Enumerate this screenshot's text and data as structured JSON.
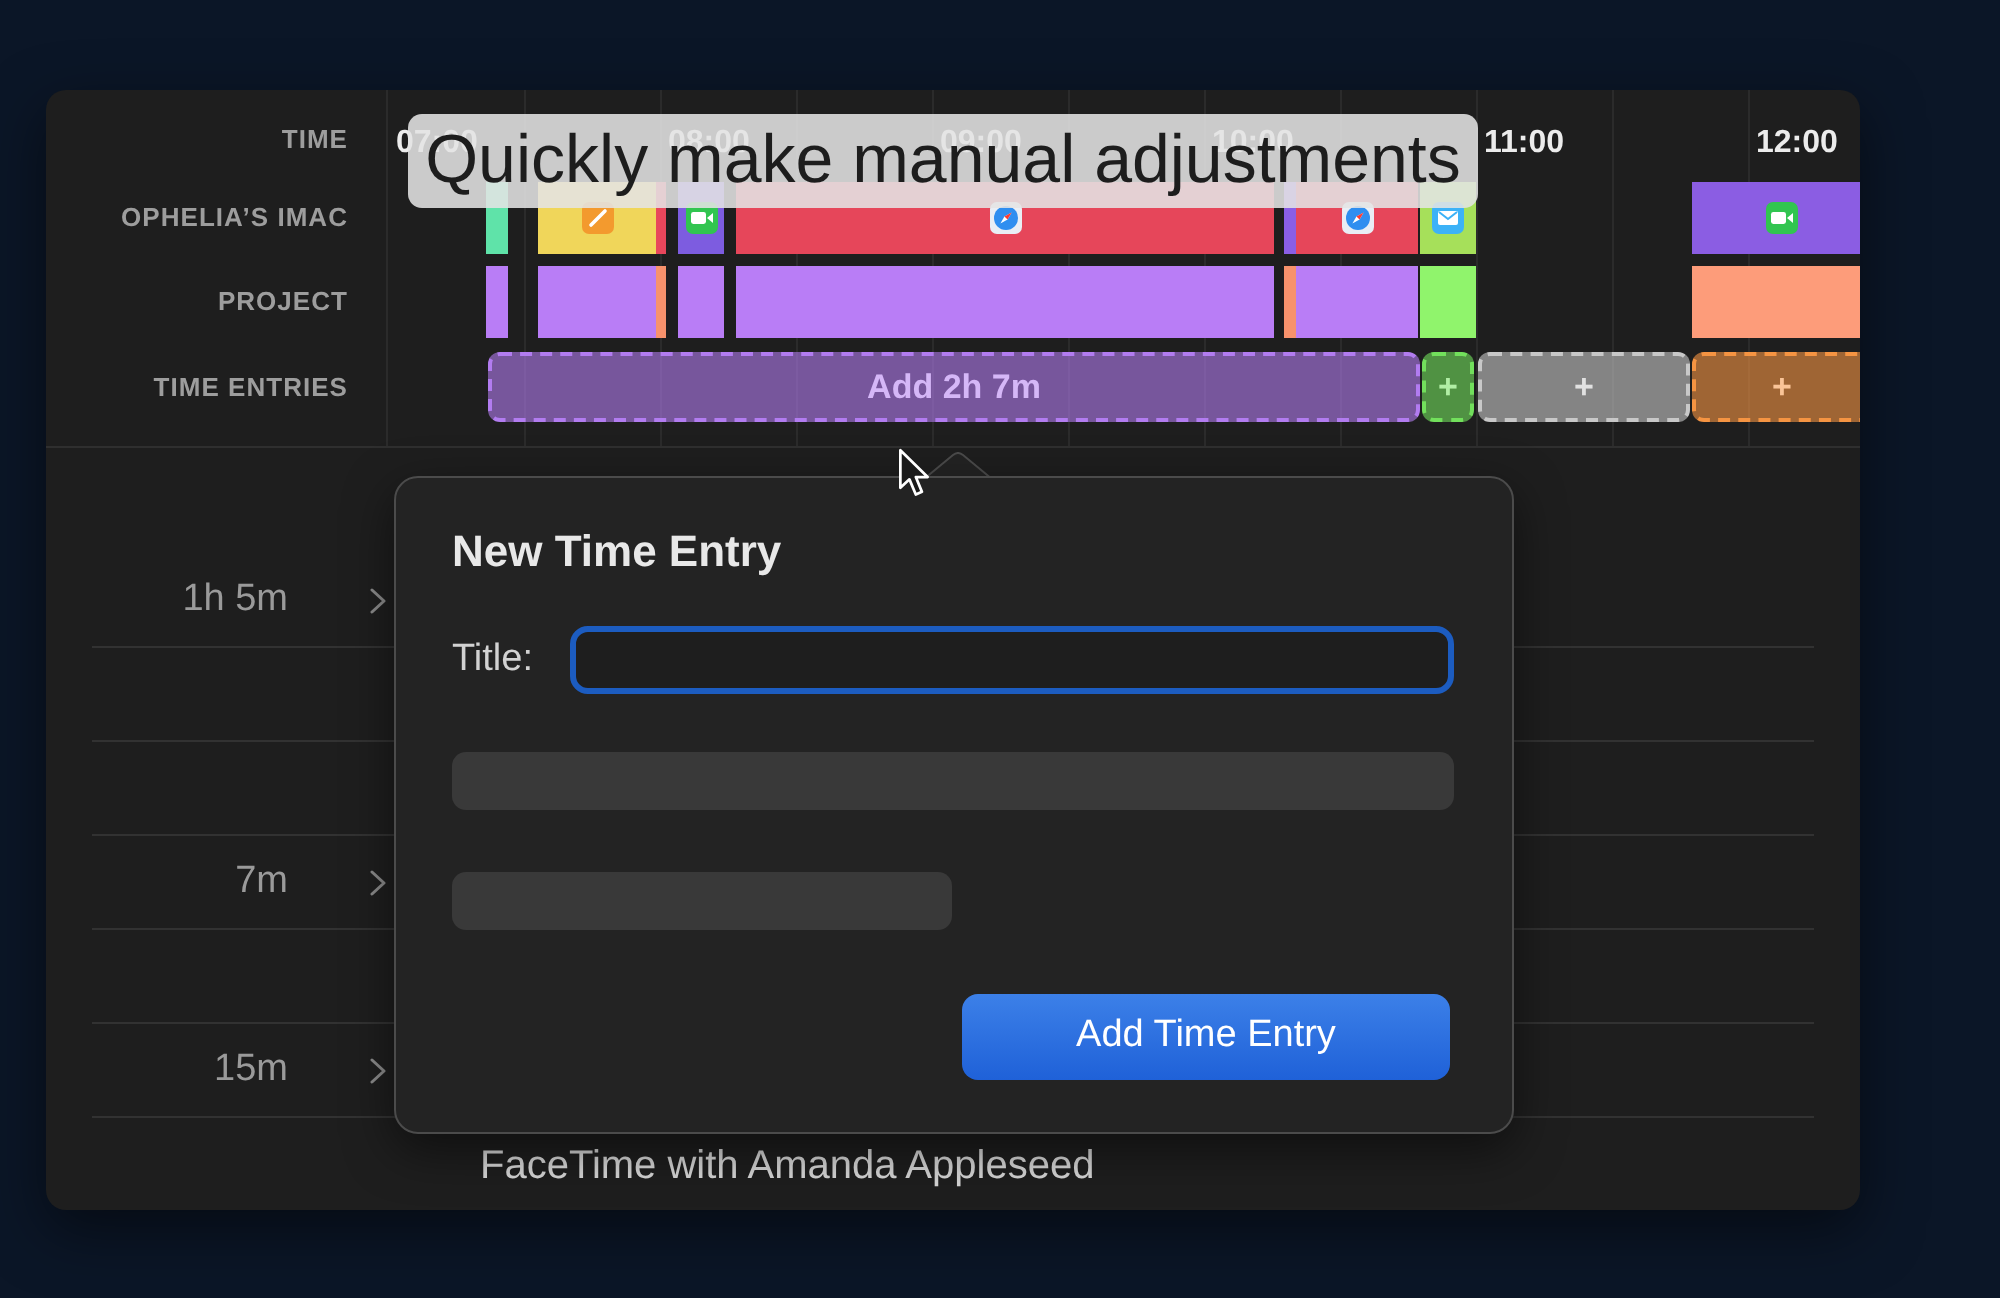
{
  "caption": "Quickly make manual adjustments",
  "timeline": {
    "row_labels": [
      "TIME",
      "OPHELIA’S IMAC",
      "PROJECT",
      "TIME ENTRIES"
    ],
    "hours": [
      "07:00",
      "08:00",
      "09:00",
      "10:00",
      "11:00",
      "12:00"
    ],
    "app_blocks": [
      {
        "color": "#5fe3a9",
        "kind": "plain"
      },
      {
        "color": "#f0d65a",
        "kind": "pencil"
      },
      {
        "color": "#e8465b",
        "kind": "plain"
      },
      {
        "color": "#7d5ce0",
        "kind": "video"
      },
      {
        "color": "#e6465a",
        "kind": "compass"
      },
      {
        "color": "#8a5ee6",
        "kind": "plain"
      },
      {
        "color": "#e6465a",
        "kind": "compass"
      },
      {
        "color": "#a6e05a",
        "kind": "envelope"
      },
      {
        "color": "#8b5de3",
        "kind": "video"
      }
    ],
    "project_blocks": [
      {
        "color": "#b97df6"
      },
      {
        "color": "#b97df6"
      },
      {
        "color": "#f7926c"
      },
      {
        "color": "#b97df6"
      },
      {
        "color": "#b97df6"
      },
      {
        "color": "#f7926c"
      },
      {
        "color": "#b97df6"
      },
      {
        "color": "#90f46c"
      },
      {
        "color": "#fd9c7a"
      }
    ],
    "time_entries": [
      {
        "label": "Add 2h 7m",
        "color": "#b27cf0"
      },
      {
        "label": "+",
        "color": "#72e05c"
      },
      {
        "label": "+",
        "color": "#c8c8c8"
      },
      {
        "label": "+",
        "color": "#f59442"
      }
    ]
  },
  "list": {
    "groups": [
      {
        "duration": "1h 5m",
        "expanded": false
      },
      {
        "duration": "7m",
        "expanded": false
      },
      {
        "duration": "15m",
        "expanded": false
      }
    ],
    "entry_title": "FaceTime with Amanda Appleseed"
  },
  "popover": {
    "title": "New Time Entry",
    "title_field": {
      "label": "Title:",
      "focused": true
    },
    "submit_button": "Add Time Entry"
  }
}
